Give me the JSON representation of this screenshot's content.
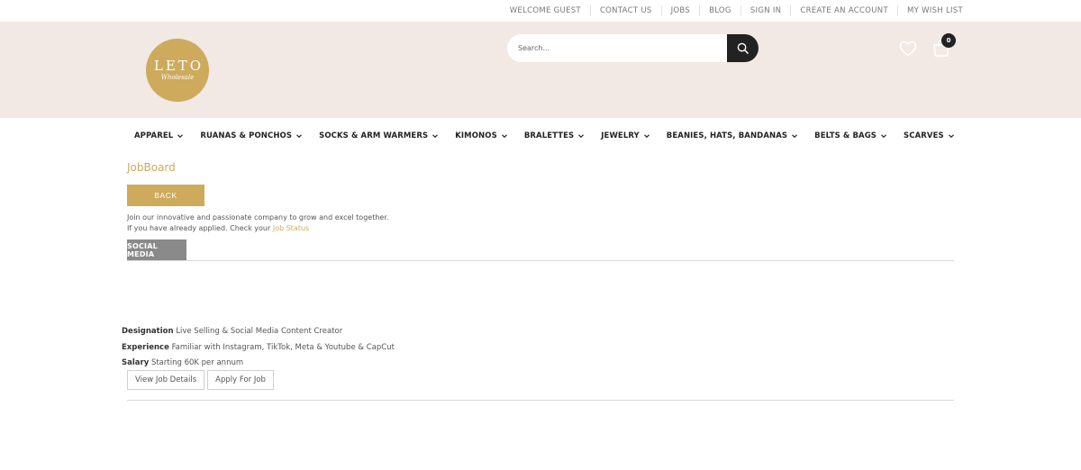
{
  "topbar": {
    "links": [
      "WELCOME GUEST",
      "CONTACT US",
      "JOBS",
      "BLOG",
      "SIGN IN",
      "CREATE AN ACCOUNT",
      "MY WISH LIST"
    ]
  },
  "header": {
    "logo": {
      "main": "LETO",
      "sub": "Wholesale"
    },
    "search": {
      "placeholder": "Search..."
    },
    "cart_count": "0",
    "icons": {
      "search": "search-icon",
      "wishlist": "heart-icon",
      "cart": "cart-icon"
    }
  },
  "nav": {
    "items": [
      "APPAREL",
      "RUANAS & PONCHOS",
      "SOCKS & ARM WARMERS",
      "KIMONOS",
      "BRALETTES",
      "JEWELRY",
      "BEANIES, HATS, BANDANAS",
      "BELTS & BAGS",
      "SCARVES"
    ]
  },
  "page": {
    "title": "JobBoard",
    "back_label": "BACK",
    "intro_line1": "Join our innovative and passionate company to grow and excel together.",
    "intro_line2_prefix": "If you have already applied. Check your ",
    "intro_link": "Job Status",
    "tab_label": "SOCIAL MEDIA"
  },
  "job": {
    "designation_label": "Designation",
    "designation_value": "Live Selling & Social Media Content Creator",
    "experience_label": "Experience",
    "experience_value": "Familiar with Instagram, TikTok, Meta & Youtube & CapCut",
    "salary_label": "Salary",
    "salary_value": "Starting 60K per annum",
    "view_label": "View Job Details",
    "apply_label": "Apply For Job"
  },
  "colors": {
    "accent": "#cdaa5c",
    "header_bg": "#f2e8e4",
    "dark": "#222222",
    "tab_bg": "#8a8a8a"
  }
}
